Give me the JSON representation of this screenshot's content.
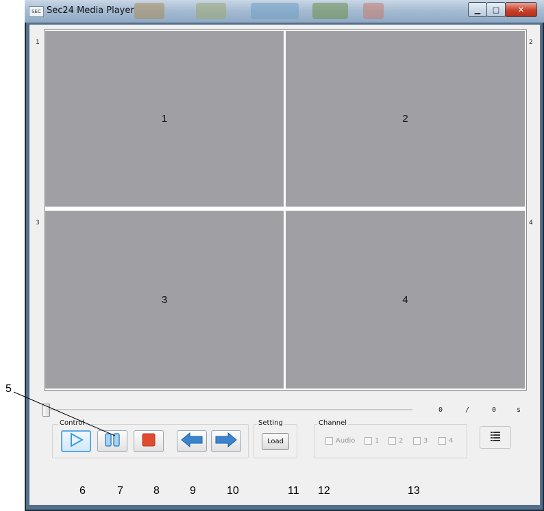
{
  "window": {
    "title": "Sec24 Media Player",
    "icon_text": "SEC",
    "minimize_glyph": "▁",
    "maximize_glyph": "□",
    "close_glyph": "✕"
  },
  "panes": [
    {
      "center": "1",
      "side": "1"
    },
    {
      "center": "2",
      "side": "2"
    },
    {
      "center": "3",
      "side": "3"
    },
    {
      "center": "4",
      "side": "4"
    }
  ],
  "playback": {
    "position": "0",
    "separator": "/",
    "duration": "0",
    "unit": "s",
    "progress": 0
  },
  "control": {
    "label": "Control",
    "buttons": [
      "play-icon",
      "pause-icon",
      "stop-icon",
      "arrow-left-icon",
      "arrow-right-icon"
    ]
  },
  "setting": {
    "label": "Setting",
    "load_label": "Load"
  },
  "channel": {
    "label": "Channel",
    "items": [
      "Audio",
      "1",
      "2",
      "3",
      "4"
    ]
  },
  "list_button_icon": "list-icon",
  "callouts": [
    "5",
    "6",
    "7",
    "8",
    "9",
    "10",
    "11",
    "12",
    "13"
  ],
  "colors": {
    "pane": "#a0a0a4",
    "play_accent": "#3b9be0",
    "stop_red": "#e04a2f",
    "arrow_blue": "#3a84d0"
  }
}
